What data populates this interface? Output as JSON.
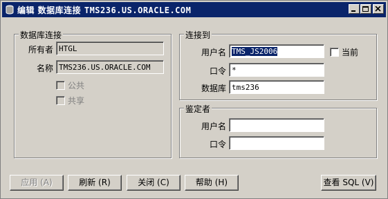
{
  "window": {
    "title_prefix": "编辑 数据库连接 ",
    "title_name": "TMS236.US.ORACLE.COM"
  },
  "db_connection": {
    "group_label": "数据库连接",
    "owner_label": "所有者",
    "owner_value": "HTGL",
    "name_label": "名称",
    "name_value": "TMS236.US.ORACLE.COM",
    "public_label": "公共",
    "shared_label": "共享"
  },
  "connect_to": {
    "group_label": "连接到",
    "username_label": "用户名",
    "username_value": "TMS_JS2006",
    "current_label": "当前",
    "password_label": "口令",
    "password_value": "*",
    "database_label": "数据库",
    "database_value": "tms236"
  },
  "authenticator": {
    "group_label": "鉴定者",
    "username_label": "用户名",
    "username_value": "",
    "password_label": "口令",
    "password_value": ""
  },
  "buttons": {
    "apply": "应用 (A)",
    "refresh": "刷新 (R)",
    "close": "关闭 (C)",
    "help": "帮助 (H)",
    "view_sql": "查看 SQL (V)"
  }
}
